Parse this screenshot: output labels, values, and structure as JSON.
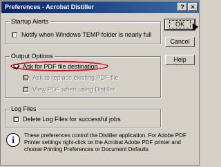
{
  "window": {
    "title": "Preferences - Acrobat Distiller"
  },
  "titlebar_buttons": {
    "help": "?",
    "close": "×"
  },
  "startup_alerts": {
    "label": "Startup Alerts",
    "notify_temp": {
      "label": "Notify when Windows TEMP folder is nearly full",
      "checked": false
    }
  },
  "output_options": {
    "label": "Output Options",
    "ask_destination": {
      "label": "Ask for PDF file destination",
      "checked": true
    },
    "ask_replace": {
      "label": "Ask to replace existing PDF file",
      "checked": true,
      "disabled": true
    },
    "view_pdf": {
      "label": "View PDF when using Distiller",
      "checked": false,
      "disabled": true
    }
  },
  "log_files": {
    "label": "Log Files",
    "delete_logs": {
      "label": "Delete Log Files for successful jobs",
      "checked": false
    }
  },
  "info": {
    "icon": "info-icon",
    "text": "These preferences control the Distiller application. For Adobe PDF Printer settings right-click on the Acrobat Adobe PDF printer and choose Printing Preferences or Document Defaults"
  },
  "buttons": {
    "ok": "OK",
    "cancel": "Cancel",
    "help": "Help"
  },
  "colors": {
    "highlight_ellipse": "#d6001c",
    "titlebar_start": "#0a246a",
    "titlebar_end": "#3a6ea5"
  }
}
